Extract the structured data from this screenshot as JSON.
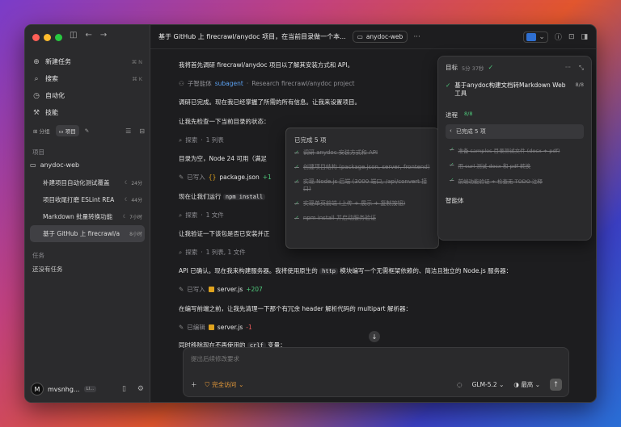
{
  "sidebar": {
    "shortcuts": {
      "new_task": "⌘ N",
      "search": "⌘ K"
    },
    "menu": [
      {
        "label": "新建任务",
        "shortcut": "⌘ N"
      },
      {
        "label": "搜索",
        "shortcut": "⌘ K"
      },
      {
        "label": "自动化",
        "shortcut": ""
      },
      {
        "label": "技能",
        "shortcut": ""
      }
    ],
    "tabs": {
      "group": "分组",
      "project": "项目"
    },
    "section_projects": "项目",
    "project_name": "anydoc-web",
    "items": [
      {
        "label": "补建项目自动化测试覆盖",
        "time": "24分"
      },
      {
        "label": "项目收尾打磨 ESLint REA",
        "time": "44分"
      },
      {
        "label": "Markdown 批量转换功能",
        "time": "7小时"
      },
      {
        "label": "基于 GitHub 上 firecrawl/a",
        "time": "8小时"
      }
    ],
    "section_tasks": "任务",
    "empty_tasks": "还没有任务",
    "user": {
      "initial": "M",
      "name": "mvsnhg...",
      "badge": "LI..."
    }
  },
  "header": {
    "title": "基于 GitHub 上 firecrawl/anydoc 项目，在当前目录做一个本...",
    "folder": "anydoc-web",
    "more": "···"
  },
  "chat": {
    "l1": "我将首先调研 firecrawl/anydoc 项目以了解其安装方式和 API。",
    "l2_label": "子智能体",
    "l2_agent": "subagent",
    "l2_desc": "Research firecrawl/anydoc project",
    "l3": "调研已完成。现在我已经掌握了所需的所有信息。让我来设置项目。",
    "l4": "让我先检查一下当前目录的状态：",
    "l5_label": "探索",
    "l5_detail": "1 列表",
    "l6": "目录为空，Node 24 可用（满足",
    "l7_label": "已写入",
    "l7_file": "package.json",
    "l7_diff": "+1",
    "l8a": "现在让我们运行",
    "l8_code": "npm install",
    "l9_label": "探索",
    "l9_detail": "1 文件",
    "l10": "让我验证一下该包是否已安装并正",
    "l11_label": "探索",
    "l11_detail": "1 列表, 1 文件",
    "l12a": "API 已确认。现在我来构建服务器。我将使用原生的",
    "l12_code": "http",
    "l12b": "模块编写一个无需框架依赖的、简洁且独立的 Node.js 服务器：",
    "l13_label": "已写入",
    "l13_file": "server.js",
    "l13_diff": "+207",
    "l14": "在编写前端之前，让我先清理一下那个有冗余 header 解析代码的 multipart 解析器：",
    "l15_label": "已编辑",
    "l15_file": "server.js",
    "l15_diff": "-1",
    "l16a": "同时移除现在不再使用的",
    "l16_code": "crlf",
    "l16b": "变量："
  },
  "popover": {
    "title": "已完成 5 项",
    "items": [
      "调研 anydoc 安装方式和 API",
      "创建项目结构 (package.json, server, frontend)",
      "实现 Node.js 后端 (3000 端口, /api/convert 接口)",
      "实现单页前端 (上传 + 展示 + 复制按钮)",
      "npm install 并启动服务验证"
    ]
  },
  "goal": {
    "label": "目标",
    "time": "5分 37秒",
    "title": "基于anydoc构建文档转Markdown Web工具",
    "count": "8/8",
    "progress_label": "进程",
    "progress_count": "8/8",
    "completed_row": "已完成 5 项",
    "items": [
      "准备 samples 目录测试文件 (docx + pdf)",
      "用 curl 测试 docx 和 pdf 转换",
      "前端功能验证 + 检查无 TODO 注释"
    ],
    "agent_label": "智能体"
  },
  "input": {
    "placeholder": "提出后续修改要求",
    "access": "完全访问",
    "model": "GLM-5.2",
    "effort": "最高"
  }
}
